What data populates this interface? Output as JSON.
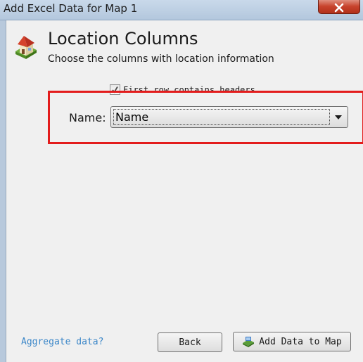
{
  "window": {
    "title": "Add Excel Data for Map 1",
    "close_icon": "close-icon"
  },
  "header": {
    "icon": "house-icon",
    "title": "Location Columns",
    "subtitle": "Choose the columns with location information"
  },
  "form": {
    "first_row_headers": {
      "label": "First row contains headers.",
      "checked": true
    },
    "name_field": {
      "label": "Name:",
      "selected": "Name"
    }
  },
  "footer": {
    "aggregate_link": "Aggregate data?",
    "back_label": "Back",
    "add_label": "Add Data to Map",
    "add_icon": "map-icon"
  },
  "colors": {
    "highlight": "#e31c1c",
    "link": "#3a86c8"
  }
}
